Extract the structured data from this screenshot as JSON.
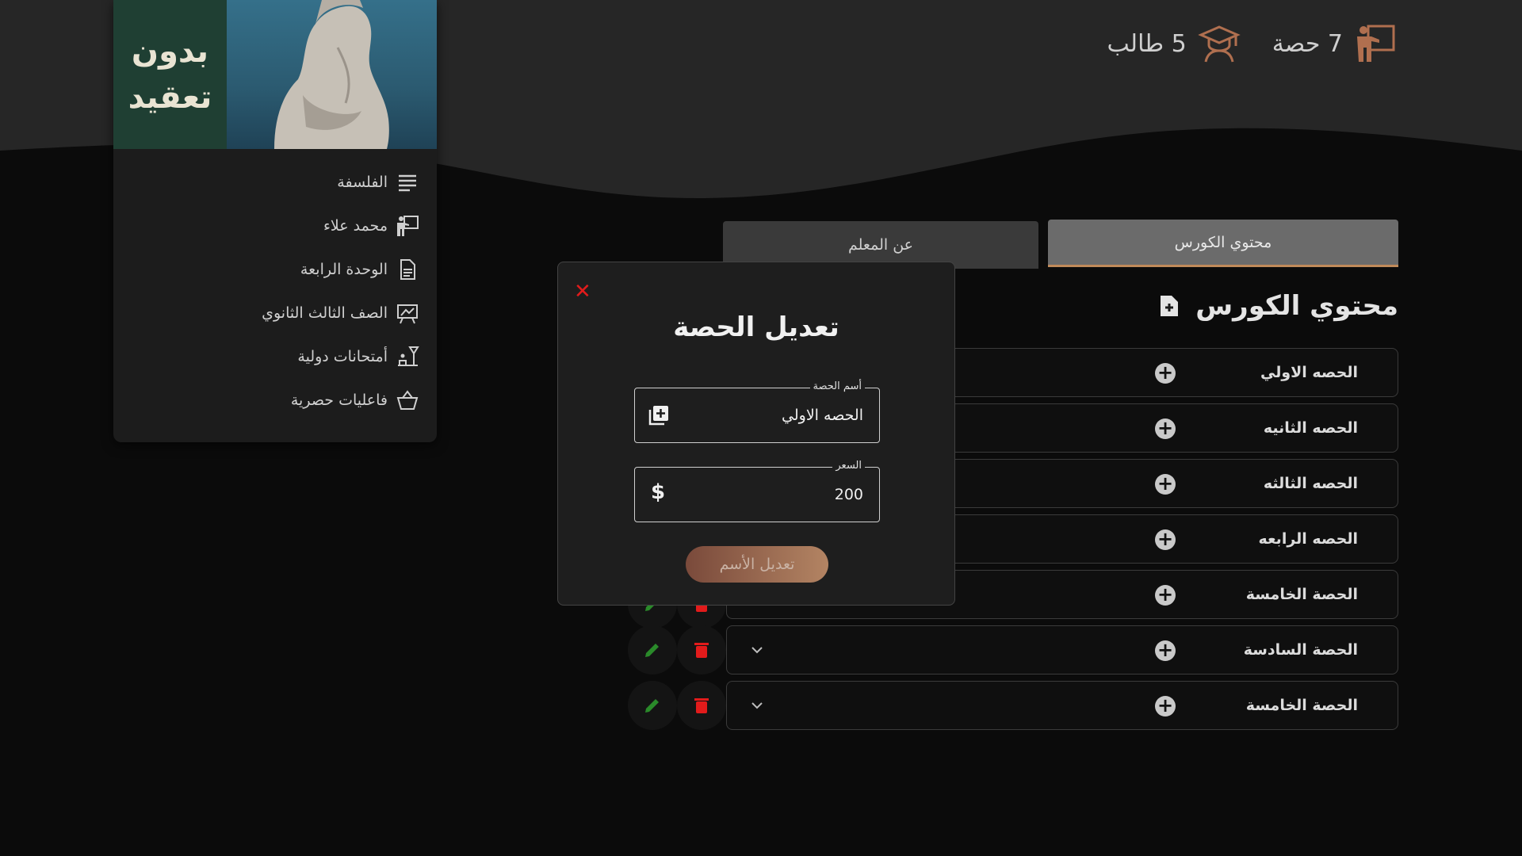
{
  "stats": {
    "lessons": "7 حصة",
    "students": "5 طالب"
  },
  "sidebar": {
    "cover_title_line1": "بدون",
    "cover_title_line2": "تعقيد",
    "items": [
      {
        "label": "الفلسفة",
        "icon": "lines-icon"
      },
      {
        "label": "محمد علاء",
        "icon": "teacher-icon"
      },
      {
        "label": "الوحدة الرابعة",
        "icon": "document-icon"
      },
      {
        "label": "الصف الثالث الثانوي",
        "icon": "board-icon"
      },
      {
        "label": "أمتحانات دولية",
        "icon": "exam-icon"
      },
      {
        "label": "فاعليات حصرية",
        "icon": "basket-icon"
      }
    ]
  },
  "tabs": {
    "content": "محتوي الكورس",
    "teacher": "عن المعلم"
  },
  "course": {
    "title": "محتوي الكورس"
  },
  "lessons": [
    {
      "name": "الحصه الاولي"
    },
    {
      "name": "الحصه الثانيه"
    },
    {
      "name": "الحصه الثالثه"
    },
    {
      "name": "الحصه الرابعه"
    },
    {
      "name": "الحصة الخامسة"
    },
    {
      "name": "الحصة السادسة"
    },
    {
      "name": "الحصة الخامسة"
    }
  ],
  "modal": {
    "close": "✕",
    "title": "تعديل الحصة",
    "name_label": "أسم الحصة",
    "name_value": "الحصه الاولي",
    "price_label": "السعر",
    "price_value": "200",
    "currency": "$",
    "submit": "تعديل الأسم"
  },
  "colors": {
    "accent": "#c08a5a",
    "danger": "#e21b1b",
    "edit": "#2a8a2a"
  }
}
